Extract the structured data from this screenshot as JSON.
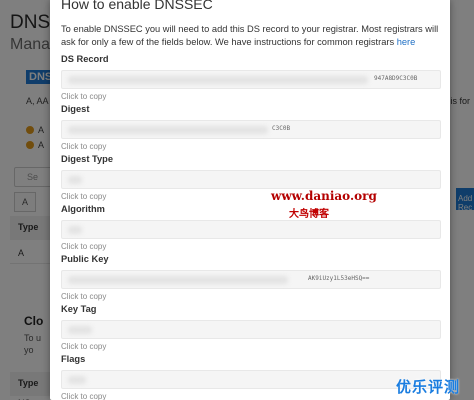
{
  "background": {
    "page_title": "DNS",
    "page_subtitle": "Manag",
    "tag": "DNS",
    "line_1": "A, AA",
    "line_2": "A",
    "line_3": "A",
    "search_placeholder": "Se",
    "filter_button": "A",
    "table_header": "Type",
    "table_cell": "A",
    "card_title": "Clo",
    "card_line_1": "To u",
    "card_line_2": "yo",
    "table2_header": "Type",
    "table2_cell": "NS",
    "right_button": "Add Rec",
    "right_text": "is for"
  },
  "modal": {
    "title": "How to enable DNSSEC",
    "description": "To enable DNSSEC you will need to add this DS record to your registrar. Most registrars will ask for only a few of the fields below. We have instructions for common registrars ",
    "description_link": "here",
    "copy_hint": "Click to copy",
    "fields": [
      {
        "label": "DS Record",
        "value_tail": "947A8D9C3C0B"
      },
      {
        "label": "Digest",
        "value_tail": "C3C0B"
      },
      {
        "label": "Digest Type",
        "value_tail": ""
      },
      {
        "label": "Algorithm",
        "value_tail": ""
      },
      {
        "label": "Public Key",
        "value_tail": "AK9iUzy1L53eHSQ=="
      },
      {
        "label": "Key Tag",
        "value_tail": ""
      },
      {
        "label": "Flags",
        "value_tail": ""
      }
    ]
  },
  "watermark": {
    "site": "www.daniao.org",
    "name": "大鸟博客",
    "corner": "优乐评测网"
  }
}
